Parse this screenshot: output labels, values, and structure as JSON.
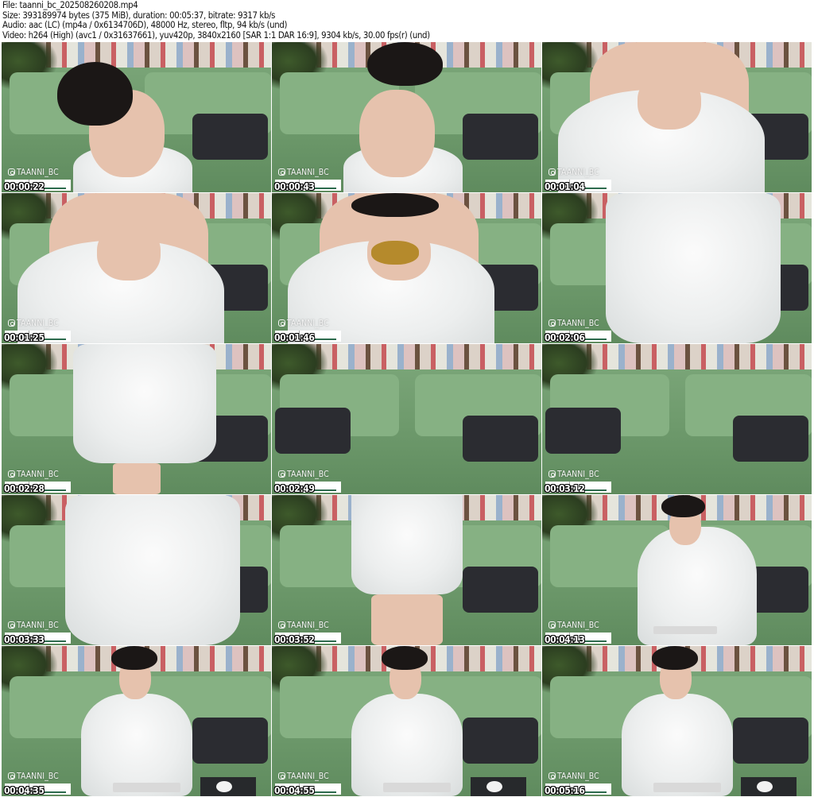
{
  "header": {
    "file": "File: taanni_bc_202508260208.mp4",
    "size": "Size: 393189974 bytes (375 MiB), duration: 00:05:37, bitrate: 9317 kb/s",
    "audio": "Audio: aac (LC) (mp4a / 0x6134706D), 48000 Hz, stereo, fltp, 94 kb/s (und)",
    "video": "Video: h264 (High) (avc1 / 0x31637661), yuv420p, 3840x2160 [SAR 1:1 DAR 16:9], 9304 kb/s, 30.00 fps(r) (und)"
  },
  "watermark": "TAANNI_BC",
  "thumbnails": [
    {
      "timestamp": "00:00:22"
    },
    {
      "timestamp": "00:00:43"
    },
    {
      "timestamp": "00:01:04"
    },
    {
      "timestamp": "00:01:25"
    },
    {
      "timestamp": "00:01:46"
    },
    {
      "timestamp": "00:02:06"
    },
    {
      "timestamp": "00:02:28"
    },
    {
      "timestamp": "00:02:49"
    },
    {
      "timestamp": "00:03:12"
    },
    {
      "timestamp": "00:03:33"
    },
    {
      "timestamp": "00:03:52"
    },
    {
      "timestamp": "00:04:13"
    },
    {
      "timestamp": "00:04:35"
    },
    {
      "timestamp": "00:04:55"
    },
    {
      "timestamp": "00:05:16"
    }
  ]
}
